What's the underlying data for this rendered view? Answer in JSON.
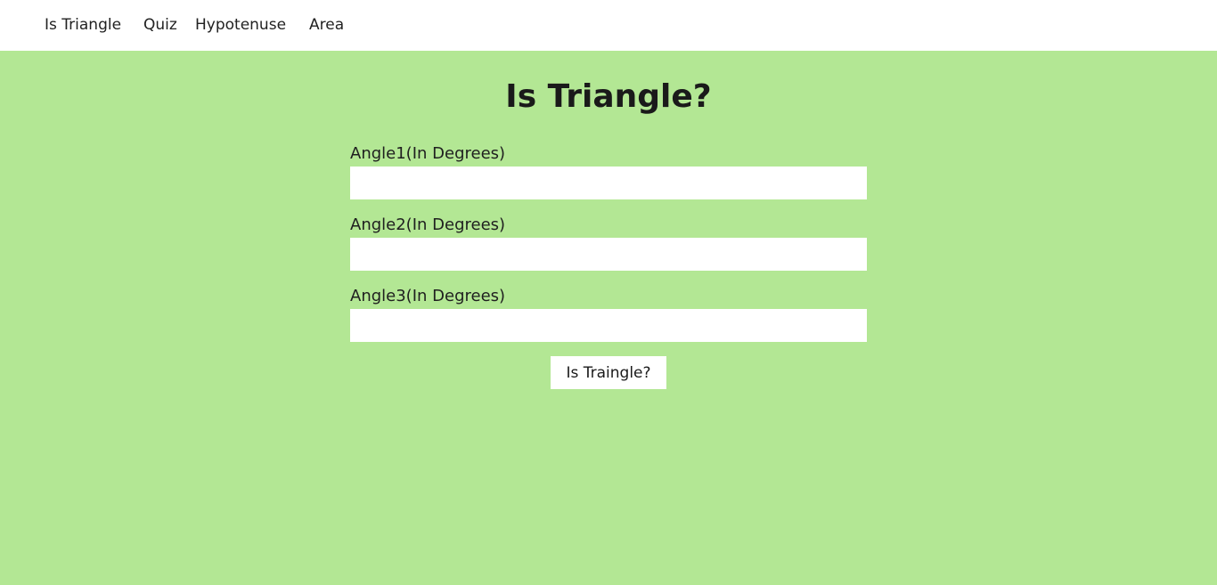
{
  "nav": {
    "items": [
      {
        "label": "Is Triangle"
      },
      {
        "label": "Quiz"
      },
      {
        "label": "Hypotenuse"
      },
      {
        "label": "Area"
      }
    ]
  },
  "main": {
    "title": "Is Triangle?",
    "fields": [
      {
        "label": "Angle1(In Degrees)",
        "value": "",
        "placeholder": ""
      },
      {
        "label": "Angle2(In Degrees)",
        "value": "",
        "placeholder": ""
      },
      {
        "label": "Angle3(In Degrees)",
        "value": "",
        "placeholder": ""
      }
    ],
    "submit_label": "Is Traingle?"
  },
  "colors": {
    "background": "#b3e794",
    "nav_background": "#ffffff"
  }
}
